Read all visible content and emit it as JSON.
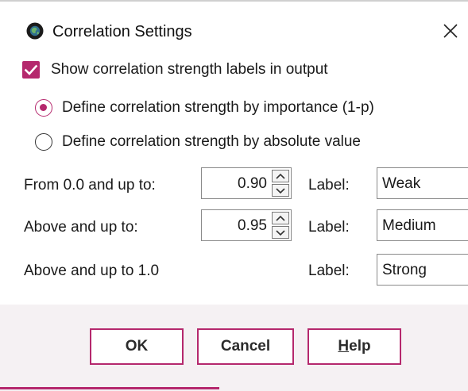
{
  "window": {
    "title": "Correlation Settings",
    "icon": "globe-icon"
  },
  "show_labels": {
    "label": "Show correlation strength labels in output",
    "checked": true
  },
  "strength_mode": {
    "options": [
      {
        "label": "Define correlation strength by importance (1-p)",
        "selected": true
      },
      {
        "label": "Define correlation strength by absolute value",
        "selected": false
      }
    ]
  },
  "thresholds": [
    {
      "range_label": "From 0.0 and up to:",
      "value": "0.90",
      "label_caption": "Label:",
      "label_value": "Weak"
    },
    {
      "range_label": "Above and up to:",
      "value": "0.95",
      "label_caption": "Label:",
      "label_value": "Medium"
    },
    {
      "range_label": "Above and up to 1.0",
      "label_caption": "Label:",
      "label_value": "Strong"
    }
  ],
  "buttons": {
    "ok": "OK",
    "cancel": "Cancel",
    "help_mnemonic": "H",
    "help_rest": "elp"
  },
  "colors": {
    "accent": "#b5286d",
    "footer_bg": "#f5f1f3"
  }
}
